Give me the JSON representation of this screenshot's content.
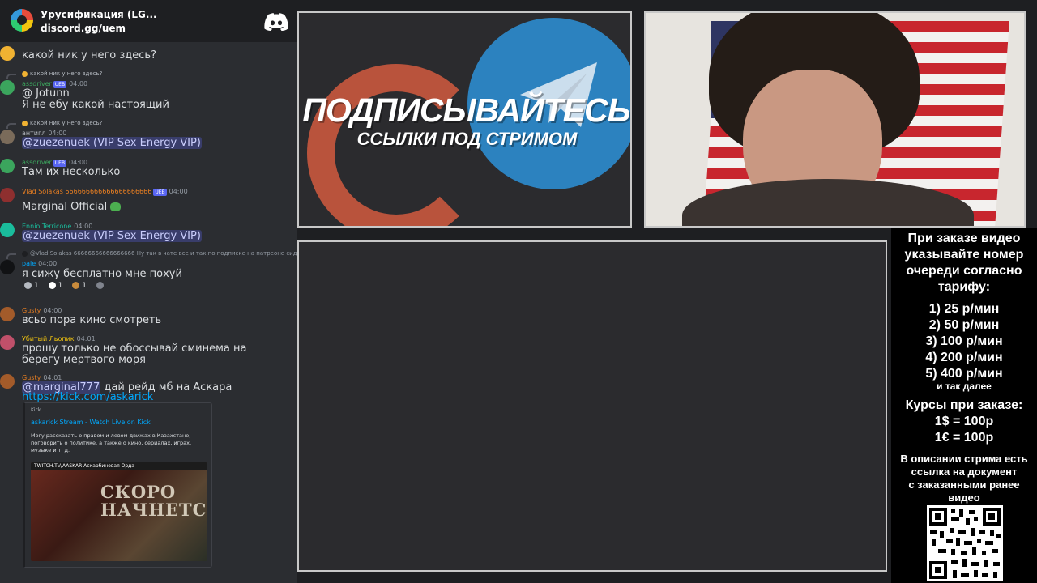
{
  "chat": {
    "server_name": "Урусификация (LG...",
    "invite": "discord.gg/uem",
    "messages": [
      {
        "text": "какой ник у него здесь?"
      },
      {
        "reply": "какой ник у него здесь?",
        "author": "assdriver",
        "badge": "UEB",
        "time": "04:00",
        "text": "@ Jotunn",
        "text2": "Я не ебу какой настоящий",
        "color": "#3ba55d"
      },
      {
        "reply": "какой ник у него здесь?",
        "author": "антигл",
        "time": "04:00",
        "mention": "@zuezenuek (VIP Sex Energy VIP)",
        "color": "#949ba4"
      },
      {
        "author": "assdriver",
        "badge": "UEB",
        "time": "04:00",
        "text": "Там их несколько",
        "color": "#3ba55d"
      },
      {
        "author": "Vlad Solakas 666666666666666666666",
        "badge": "UEB",
        "time": "04:00",
        "text": "Marginal Official",
        "color": "#e67e22"
      },
      {
        "author": "Ennio Terricone",
        "time": "04:00",
        "mention": "@zuezenuek (VIP Sex Energy VIP)",
        "color": "#1abc9c"
      },
      {
        "reply": "Ну так в чате все и так по подписке на патреоне сидят",
        "reply_author": "@Vlad Solakas 66666666666666666",
        "author": "pale",
        "time": "04:00",
        "text": "я сижу бесплатно мне похуй",
        "color": "#00a8fc"
      },
      {
        "author": "Gusty",
        "time": "04:00",
        "text": "всьо пора кино смотреть",
        "color": "#e67e22"
      },
      {
        "author": "Убитый Льопик",
        "time": "04:01",
        "text": "прошу только не обоссывай сминема на берегу мертвого моря",
        "color": "#f1c40f"
      },
      {
        "author": "Gusty",
        "time": "04:01",
        "mention": "@marginal777",
        "text": " дай рейд мб на Аскара",
        "link": "https://kick.com/askarick",
        "color": "#e67e22"
      }
    ],
    "reactions": [
      "1",
      "1",
      "1"
    ],
    "embed": {
      "provider": "Kick",
      "title": "askarick Stream - Watch Live on Kick",
      "description": "Могу рассказать о правом и левом движах в Казахстане, поговорить о политике, а также о кино, сериалах, играх, музыке и т. д.",
      "thumb_bar": "TWITCH.TV/AASKAR  Аскарбиновая Орда",
      "thumb_text": "СКОРО НАЧНЕТСЯ"
    }
  },
  "promo": {
    "title": "ПОДПИСЫВАЙТЕСЬ",
    "subtitle": "ССЫЛКИ ПОД СТРИМОМ"
  },
  "info": {
    "line1": "При заказе видео",
    "line2": "указывайте номер",
    "line3": "очереди согласно",
    "line4": "тарифу:",
    "tariffs": [
      "1) 25 р/мин",
      "2) 50 р/мин",
      "3) 100 р/мин",
      "4) 200 р/мин",
      "5) 400 р/мин"
    ],
    "etc": "и так далее",
    "rates_title": "Курсы при заказе:",
    "rate1": "1$ = 100р",
    "rate2": "1€ = 100р",
    "doc1": "В описании стрима есть",
    "doc2": "ссылка на документ",
    "doc3": "с заказанными ранее",
    "doc4": "видео"
  }
}
